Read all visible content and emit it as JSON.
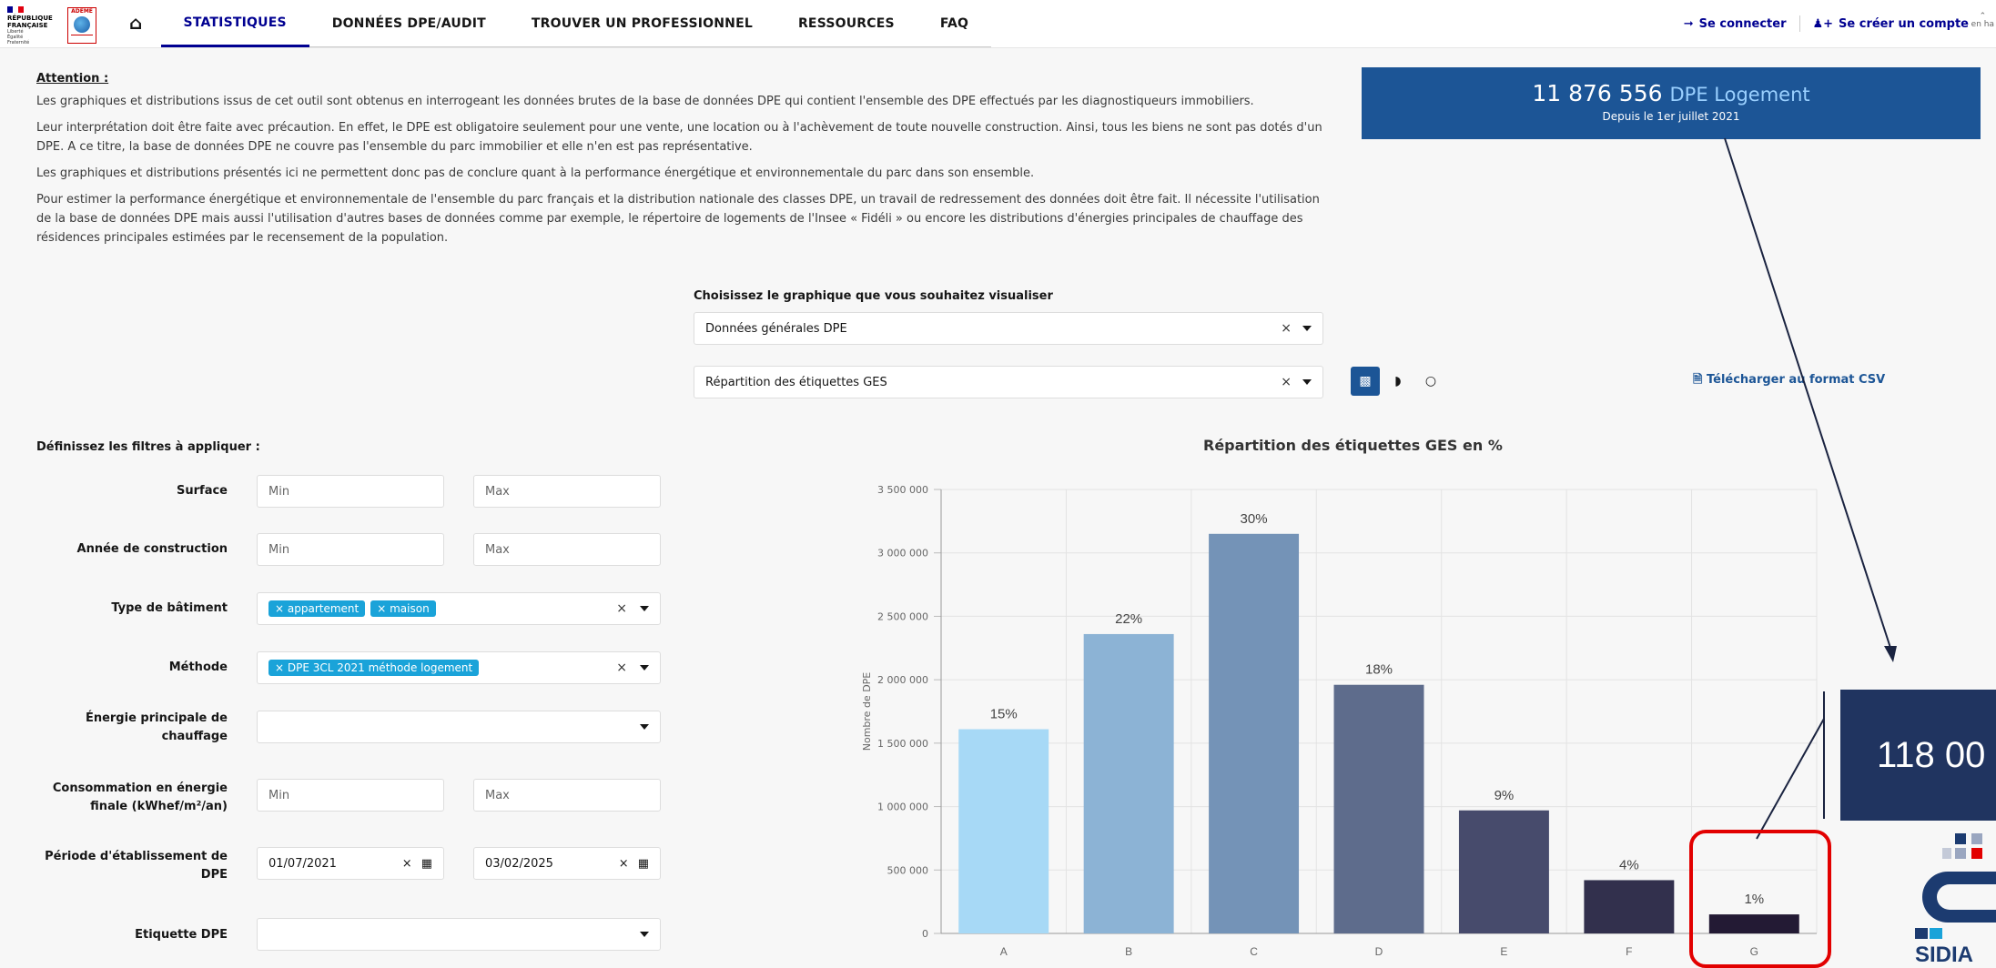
{
  "header": {
    "rf_logo_lines": [
      "RÉPUBLIQUE",
      "FRANÇAISE"
    ],
    "rf_motto": [
      "Liberté",
      "Égalité",
      "Fraternité"
    ],
    "ademe_label": "ADEME",
    "nav": [
      "STATISTIQUES",
      "DONNÉES DPE/AUDIT",
      "TROUVER UN PROFESSIONNEL",
      "RESSOURCES",
      "FAQ"
    ],
    "login": "Se connecter",
    "signup": "Se créer un compte",
    "scroll_top": "en ha"
  },
  "notice": {
    "title": "Attention :",
    "paragraphs": [
      "Les graphiques et distributions issus de cet outil sont obtenus en interrogeant les données brutes de la base de données DPE qui contient l'ensemble des DPE effectués par les diagnostiqueurs immobiliers.",
      "Leur interprétation doit être faite avec précaution. En effet, le DPE est obligatoire seulement pour une vente, une location ou à l'achèvement de toute nouvelle construction. Ainsi, tous les biens ne sont pas dotés d'un DPE. A ce titre, la base de données DPE ne couvre pas l'ensemble du parc immobilier et elle n'en est pas représentative.",
      "Les graphiques et distributions présentés ici ne permettent donc pas de conclure quant à la performance énergétique et environnementale du parc dans son ensemble.",
      "Pour estimer la performance énergétique et environnementale de l'ensemble du parc français et la distribution nationale des classes DPE, un travail de redressement des données doit être fait. Il nécessite l'utilisation de la base de données DPE mais aussi l'utilisation d'autres bases de données comme par exemple, le répertoire de logements de l'Insee « Fidéli » ou encore les distributions d'énergies principales de chauffage des résidences principales estimées par le recensement de la population."
    ]
  },
  "stat": {
    "number": "11 876 556",
    "label": "DPE Logement",
    "since": "Depuis le 1er juillet 2021"
  },
  "chooser": {
    "label": "Choisissez le graphique que vous souhaitez visualiser",
    "select1": "Données générales DPE",
    "select2": "Répartition des étiquettes GES",
    "csv": "Télécharger au format CSV"
  },
  "filters": {
    "title": "Définissez les filtres à appliquer :",
    "surface": "Surface",
    "annee": "Année de construction",
    "type": "Type de bâtiment",
    "methode": "Méthode",
    "energie": "Énergie principale de chauffage",
    "conso": "Consommation en énergie finale (kWhef/m²/an)",
    "periode": "Période d'établissement de DPE",
    "etiquette": "Etiquette DPE",
    "min": "Min",
    "max": "Max",
    "type_chips": [
      "appartement",
      "maison"
    ],
    "methode_chips": [
      "DPE 3CL 2021 méthode logement"
    ],
    "date_from": "01/07/2021",
    "date_to": "03/02/2025"
  },
  "overlay": {
    "big_number": "118 00",
    "logo_word": "SIDIA"
  },
  "colors": {
    "primary": "#000091",
    "accent": "#1c5596",
    "chip": "#1aa3d9",
    "highlight": "#e20000"
  },
  "chart_data": {
    "type": "bar",
    "title": "Répartition des étiquettes GES en %",
    "ylabel": "Nombre de DPE",
    "categories": [
      "A",
      "B",
      "C",
      "D",
      "E",
      "F",
      "G"
    ],
    "values": [
      1610000,
      2360000,
      3150000,
      1960000,
      970000,
      420000,
      150000
    ],
    "labels": [
      "15%",
      "22%",
      "30%",
      "18%",
      "9%",
      "4%",
      "1%"
    ],
    "colors": [
      "#a7d9f6",
      "#8cb3d5",
      "#7493b7",
      "#5e6c8c",
      "#474b6c",
      "#32304d",
      "#231a34"
    ],
    "yticks": [
      0,
      500000,
      1000000,
      1500000,
      2000000,
      2500000,
      3000000,
      3500000
    ],
    "ytick_labels": [
      "0",
      "500 000",
      "1 000 000",
      "1 500 000",
      "2 000 000",
      "2 500 000",
      "3 000 000",
      "3 500 000"
    ],
    "ylim": [
      0,
      3500000
    ],
    "grid": true
  }
}
